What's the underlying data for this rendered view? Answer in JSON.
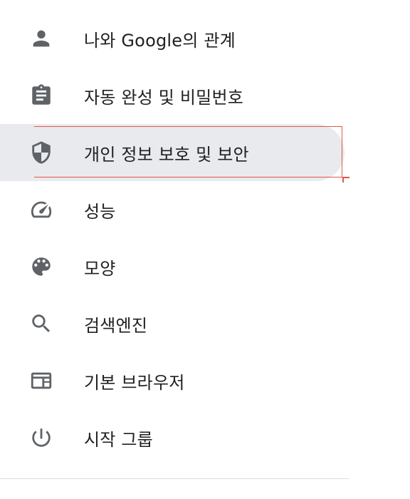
{
  "sidebar": {
    "items": [
      {
        "label": "나와 Google의 관계",
        "icon": "person-icon"
      },
      {
        "label": "자동 완성 및 비밀번호",
        "icon": "clipboard-icon"
      },
      {
        "label": "개인 정보 보호 및 보안",
        "icon": "shield-icon",
        "selected": true
      },
      {
        "label": "성능",
        "icon": "speedometer-icon"
      },
      {
        "label": "모양",
        "icon": "palette-icon"
      },
      {
        "label": "검색엔진",
        "icon": "search-icon"
      },
      {
        "label": "기본 브라우저",
        "icon": "browser-window-icon"
      },
      {
        "label": "시작 그룹",
        "icon": "power-icon"
      }
    ]
  },
  "colors": {
    "selected_background": "#e8eaed",
    "icon": "#5f6368",
    "text": "#202124",
    "annotation": "#e4574a"
  }
}
